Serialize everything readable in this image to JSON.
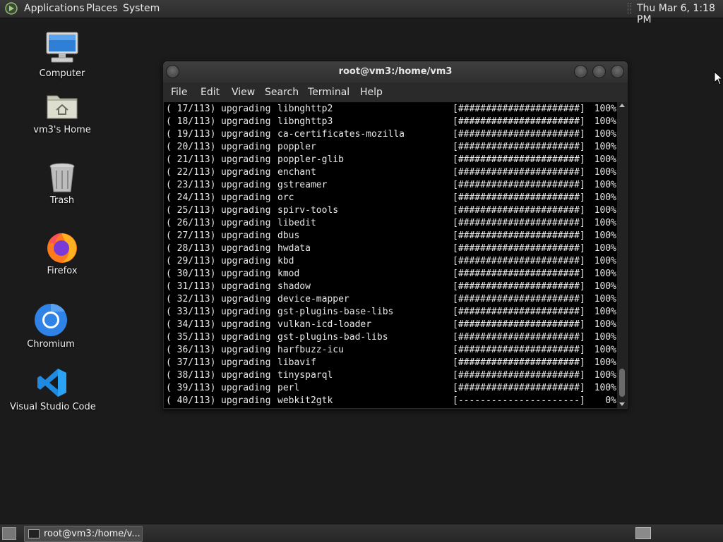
{
  "top_panel": {
    "menus": [
      "Applications",
      "Places",
      "System"
    ],
    "clock": "Thu Mar  6,  1:18 PM"
  },
  "desktop": {
    "icons": [
      {
        "label": "Computer",
        "icon": "computer-icon"
      },
      {
        "label": "vm3's Home",
        "icon": "home-folder-icon"
      },
      {
        "label": "Trash",
        "icon": "trash-icon"
      },
      {
        "label": "Firefox",
        "icon": "firefox-icon"
      },
      {
        "label": "Chromium",
        "icon": "chromium-icon"
      },
      {
        "label": "Visual Studio Code",
        "icon": "vscode-icon"
      }
    ]
  },
  "terminal": {
    "title": "root@vm3:/home/vm3",
    "menu": [
      "File",
      "Edit",
      "View",
      "Search",
      "Terminal",
      "Help"
    ],
    "lines": [
      {
        "num": "( 17/113)",
        "action": "upgrading",
        "pkg": "libnghttp2",
        "bar": "[######################]",
        "pct": "100%"
      },
      {
        "num": "( 18/113)",
        "action": "upgrading",
        "pkg": "libnghttp3",
        "bar": "[######################]",
        "pct": "100%"
      },
      {
        "num": "( 19/113)",
        "action": "upgrading",
        "pkg": "ca-certificates-mozilla",
        "bar": "[######################]",
        "pct": "100%"
      },
      {
        "num": "( 20/113)",
        "action": "upgrading",
        "pkg": "poppler",
        "bar": "[######################]",
        "pct": "100%"
      },
      {
        "num": "( 21/113)",
        "action": "upgrading",
        "pkg": "poppler-glib",
        "bar": "[######################]",
        "pct": "100%"
      },
      {
        "num": "( 22/113)",
        "action": "upgrading",
        "pkg": "enchant",
        "bar": "[######################]",
        "pct": "100%"
      },
      {
        "num": "( 23/113)",
        "action": "upgrading",
        "pkg": "gstreamer",
        "bar": "[######################]",
        "pct": "100%"
      },
      {
        "num": "( 24/113)",
        "action": "upgrading",
        "pkg": "orc",
        "bar": "[######################]",
        "pct": "100%"
      },
      {
        "num": "( 25/113)",
        "action": "upgrading",
        "pkg": "spirv-tools",
        "bar": "[######################]",
        "pct": "100%"
      },
      {
        "num": "( 26/113)",
        "action": "upgrading",
        "pkg": "libedit",
        "bar": "[######################]",
        "pct": "100%"
      },
      {
        "num": "( 27/113)",
        "action": "upgrading",
        "pkg": "dbus",
        "bar": "[######################]",
        "pct": "100%"
      },
      {
        "num": "( 28/113)",
        "action": "upgrading",
        "pkg": "hwdata",
        "bar": "[######################]",
        "pct": "100%"
      },
      {
        "num": "( 29/113)",
        "action": "upgrading",
        "pkg": "kbd",
        "bar": "[######################]",
        "pct": "100%"
      },
      {
        "num": "( 30/113)",
        "action": "upgrading",
        "pkg": "kmod",
        "bar": "[######################]",
        "pct": "100%"
      },
      {
        "num": "( 31/113)",
        "action": "upgrading",
        "pkg": "shadow",
        "bar": "[######################]",
        "pct": "100%"
      },
      {
        "num": "( 32/113)",
        "action": "upgrading",
        "pkg": "device-mapper",
        "bar": "[######################]",
        "pct": "100%"
      },
      {
        "num": "( 33/113)",
        "action": "upgrading",
        "pkg": "gst-plugins-base-libs",
        "bar": "[######################]",
        "pct": "100%"
      },
      {
        "num": "( 34/113)",
        "action": "upgrading",
        "pkg": "vulkan-icd-loader",
        "bar": "[######################]",
        "pct": "100%"
      },
      {
        "num": "( 35/113)",
        "action": "upgrading",
        "pkg": "gst-plugins-bad-libs",
        "bar": "[######################]",
        "pct": "100%"
      },
      {
        "num": "( 36/113)",
        "action": "upgrading",
        "pkg": "harfbuzz-icu",
        "bar": "[######################]",
        "pct": "100%"
      },
      {
        "num": "( 37/113)",
        "action": "upgrading",
        "pkg": "libavif",
        "bar": "[######################]",
        "pct": "100%"
      },
      {
        "num": "( 38/113)",
        "action": "upgrading",
        "pkg": "tinysparql",
        "bar": "[######################]",
        "pct": "100%"
      },
      {
        "num": "( 39/113)",
        "action": "upgrading",
        "pkg": "perl",
        "bar": "[######################]",
        "pct": "100%"
      },
      {
        "num": "( 40/113)",
        "action": "upgrading",
        "pkg": "webkit2gtk",
        "bar": "[----------------------]",
        "pct": "0%"
      }
    ]
  },
  "taskbar": {
    "task_label": "root@vm3:/home/v..."
  }
}
